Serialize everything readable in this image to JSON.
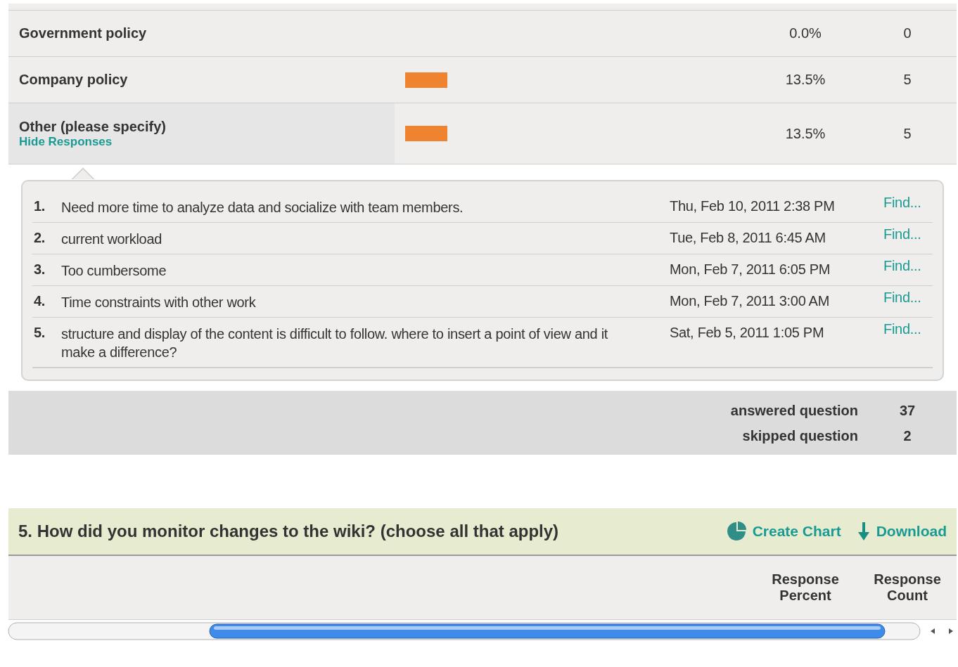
{
  "answer_rows": [
    {
      "label": "Government policy",
      "percent": "0.0%",
      "count": "0"
    },
    {
      "label": "Company policy",
      "percent": "13.5%",
      "count": "5"
    },
    {
      "label": "Other (please specify)",
      "link": "Hide Responses",
      "percent": "13.5%",
      "count": "5"
    }
  ],
  "responses": [
    {
      "number": "1.",
      "text": "Need more time to analyze data and socialize with team members.",
      "date": "Thu, Feb 10, 2011 2:38 PM",
      "action": "Find..."
    },
    {
      "number": "2.",
      "text": "current workload",
      "date": "Tue, Feb 8, 2011 6:45 AM",
      "action": "Find..."
    },
    {
      "number": "3.",
      "text": "Too cumbersome",
      "date": "Mon, Feb 7, 2011 6:05 PM",
      "action": "Find..."
    },
    {
      "number": "4.",
      "text": "Time constraints with other work",
      "date": "Mon, Feb 7, 2011 3:00 AM",
      "action": "Find..."
    },
    {
      "number": "5.",
      "text": "structure and display of the content is difficult to follow. where to insert a point of view and it make a difference?",
      "date": "Sat, Feb 5, 2011 1:05 PM",
      "action": "Find..."
    }
  ],
  "summary": [
    {
      "label": "answered question",
      "value": "37"
    },
    {
      "label": "skipped question",
      "value": "2"
    }
  ],
  "next_question": {
    "title": "5. How did you monitor changes to the wiki? (choose all that apply)",
    "create_chart": "Create Chart",
    "download": "Download",
    "columns": [
      "Response Percent",
      "Response Count"
    ]
  }
}
